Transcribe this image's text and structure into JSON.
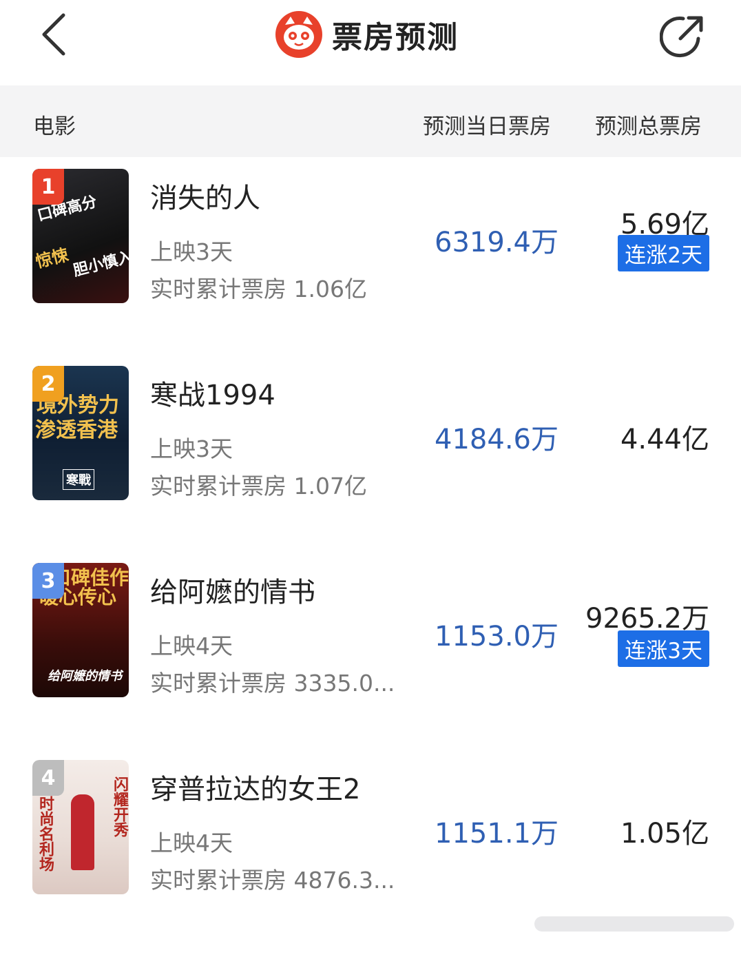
{
  "navbar": {
    "title": "票房预测",
    "back_icon": "chevron-left-icon",
    "share_icon": "share-icon",
    "logo_icon": "cat-logo-icon",
    "accent": "#e8412b"
  },
  "header": {
    "movie": "电影",
    "daily": "预测当日票房",
    "total": "预测总票房"
  },
  "colors": {
    "daily_value": "#2f5fb3",
    "badge_bg": "#1d6ee6",
    "rank1": "#e8412b",
    "rank2": "#f0a020",
    "rank3": "#5b8ee6",
    "rank4": "#bdbdbd"
  },
  "movies": [
    {
      "rank": "1",
      "name": "消失的人",
      "days": "上映3天",
      "cumulative": "实时累计票房 1.06亿",
      "daily": "6319.4万",
      "total": "5.69亿",
      "badge": "连涨2天",
      "poster_text": [
        "口碑高分",
        "惊悚",
        "胆小慎入"
      ]
    },
    {
      "rank": "2",
      "name": "寒战1994",
      "days": "上映3天",
      "cumulative": "实时累计票房 1.07亿",
      "daily": "4184.6万",
      "total": "4.44亿",
      "badge": "",
      "poster_text": [
        "境外势力",
        "渗透香港",
        "寒戰"
      ]
    },
    {
      "rank": "3",
      "name": "给阿嬷的情书",
      "days": "上映4天",
      "cumulative": "实时累计票房 3335.0...",
      "daily": "1153.0万",
      "total": "9265.2万",
      "badge": "连涨3天",
      "poster_text": [
        "口碑佳作",
        "暖心传心",
        "给阿嬷的情书"
      ]
    },
    {
      "rank": "4",
      "name": "穿普拉达的女王2",
      "days": "上映4天",
      "cumulative": "实时累计票房 4876.3...",
      "daily": "1151.1万",
      "total": "1.05亿",
      "badge": "",
      "poster_text": [
        "时尚名利场",
        "闪耀开秀"
      ]
    }
  ]
}
